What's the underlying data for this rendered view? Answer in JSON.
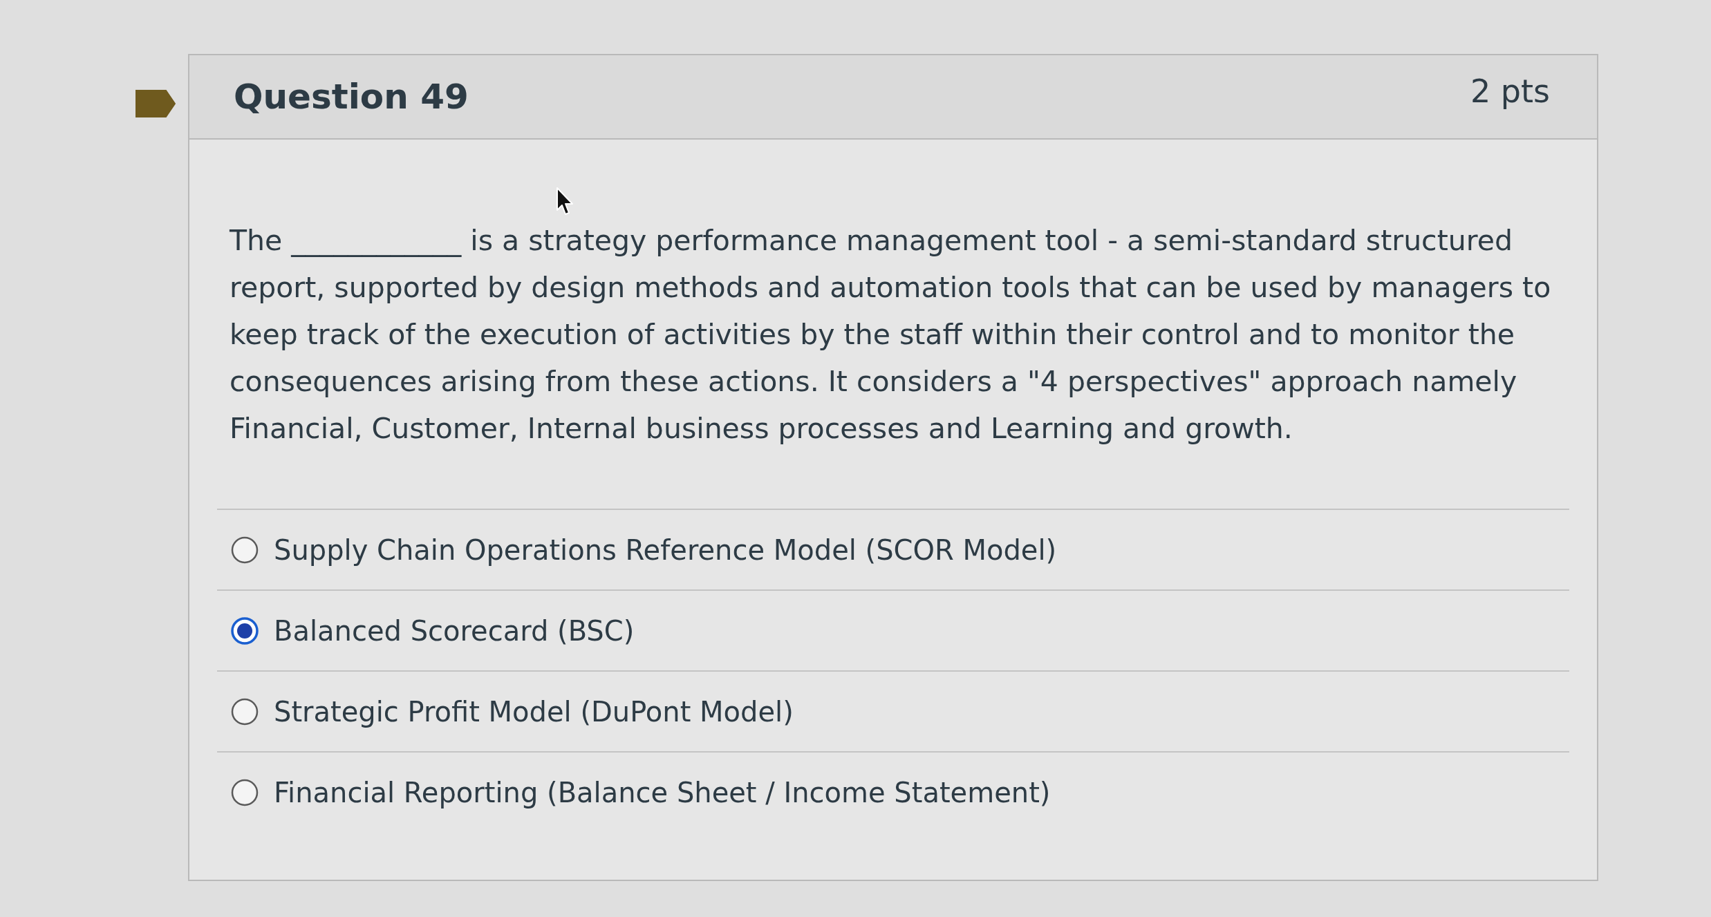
{
  "question": {
    "flagged": true,
    "title": "Question 49",
    "points": "2 pts",
    "text": "The ____________ is a strategy performance management tool - a semi-standard structured report, supported by design methods and automation tools that can be used by managers to keep track of the execution of activities by the staff within their control and to monitor the consequences arising from these actions. It considers a \"4 perspectives\" approach namely Financial, Customer, Internal business processes and Learning and growth.",
    "answers": [
      {
        "label": "Supply Chain Operations Reference Model (SCOR Model)",
        "selected": false
      },
      {
        "label": "Balanced Scorecard (BSC)",
        "selected": true
      },
      {
        "label": "Strategic Profit Model (DuPont Model)",
        "selected": false
      },
      {
        "label": "Financial Reporting (Balance Sheet / Income Statement)",
        "selected": false
      }
    ]
  }
}
